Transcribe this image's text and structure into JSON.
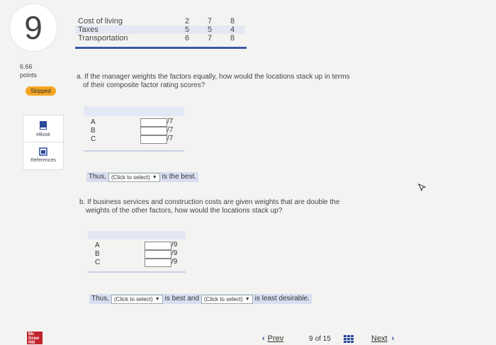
{
  "question": {
    "number": "9",
    "points_value": "6.66",
    "points_label": "points",
    "status_badge": "Skipped"
  },
  "sidebar": {
    "ebook_label": "eBook",
    "references_label": "References"
  },
  "factor_table": {
    "rows": [
      {
        "label": "Cost of living",
        "values": [
          "2",
          "7",
          "8"
        ]
      },
      {
        "label": "Taxes",
        "values": [
          "5",
          "5",
          "4"
        ]
      },
      {
        "label": "Transportation",
        "values": [
          "6",
          "7",
          "8"
        ]
      }
    ]
  },
  "part_a": {
    "prompt_line1": "a. If the manager weights the factors equally, how would the locations stack up in terms",
    "prompt_line2": "of their composite factor rating scores?",
    "rows": [
      {
        "letter": "A",
        "suffix": "/7"
      },
      {
        "letter": "B",
        "suffix": "/7"
      },
      {
        "letter": "C",
        "suffix": "/7"
      }
    ],
    "thus_prefix": "Thus,",
    "select_label": "(Click to select)",
    "thus_suffix": "is the best."
  },
  "part_b": {
    "prompt_line1": "b. If business services and construction costs are given weights that are double the",
    "prompt_line2": "weights of the other factors, how would the locations stack up?",
    "rows": [
      {
        "letter": "A",
        "suffix": "/9"
      },
      {
        "letter": "B",
        "suffix": "/9"
      },
      {
        "letter": "C",
        "suffix": "/9"
      }
    ],
    "thus_prefix": "Thus,",
    "select1_label": "(Click to select)",
    "middle_text": "is best and",
    "select2_label": "(Click to select)",
    "thus_suffix": "is least desirable."
  },
  "footer": {
    "logo_text": "Mc Graw Hill",
    "prev_label": "Prev",
    "page_current": "9",
    "page_of": "of 15",
    "next_label": "Next"
  },
  "colors": {
    "accent_blue": "#3a5aa8",
    "badge_orange": "#f5a622",
    "logo_red": "#c0232b"
  }
}
